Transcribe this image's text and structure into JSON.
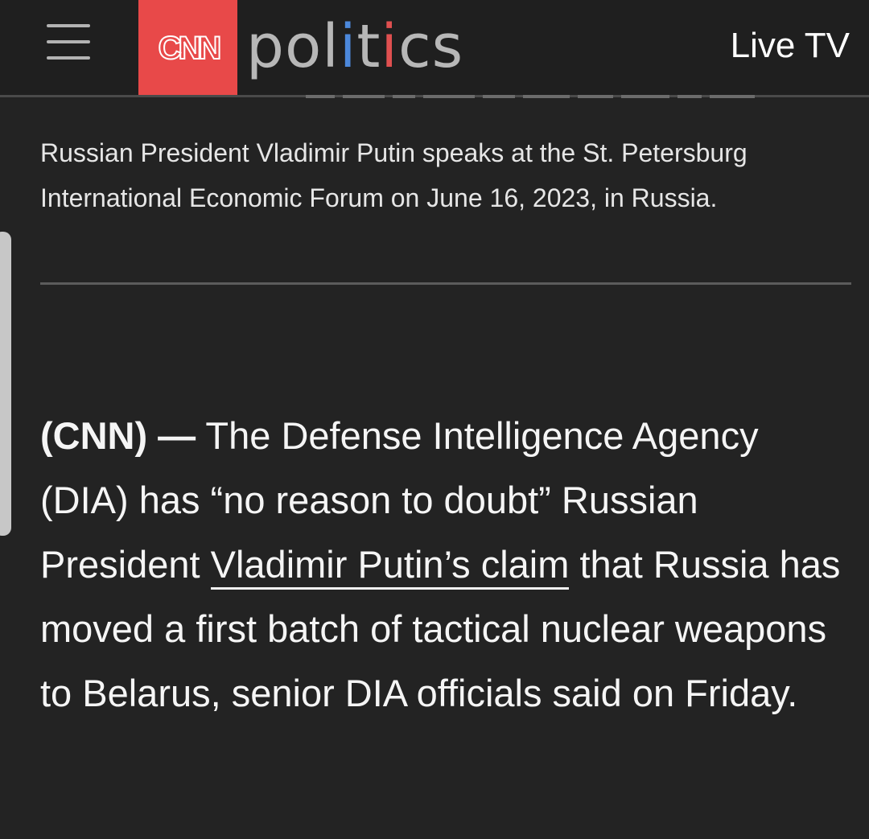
{
  "header": {
    "menu_icon": "hamburger-menu-icon",
    "brand": "CNN",
    "section": "politics",
    "live_tv_label": "Live TV",
    "colors": {
      "cnn_red": "#e84949",
      "politics_gray": "#b7b7b7",
      "politics_blue": "#4c88db",
      "politics_red": "#e05050"
    }
  },
  "caption": {
    "text": "Russian President Vladimir Putin speaks at the St. Petersburg International Economic Forum on June 16, 2023, in Russia."
  },
  "article": {
    "dateline": "(CNN) —",
    "text_before_link": " The Defense Intelligence Agency (DIA) has “no reason to doubt” Russian President ",
    "link_text": "Vladimir Putin’s claim",
    "text_after_link": " that Russia has moved a first batch of tactical nuclear weapons to Belarus, senior DIA officials said on Friday."
  }
}
